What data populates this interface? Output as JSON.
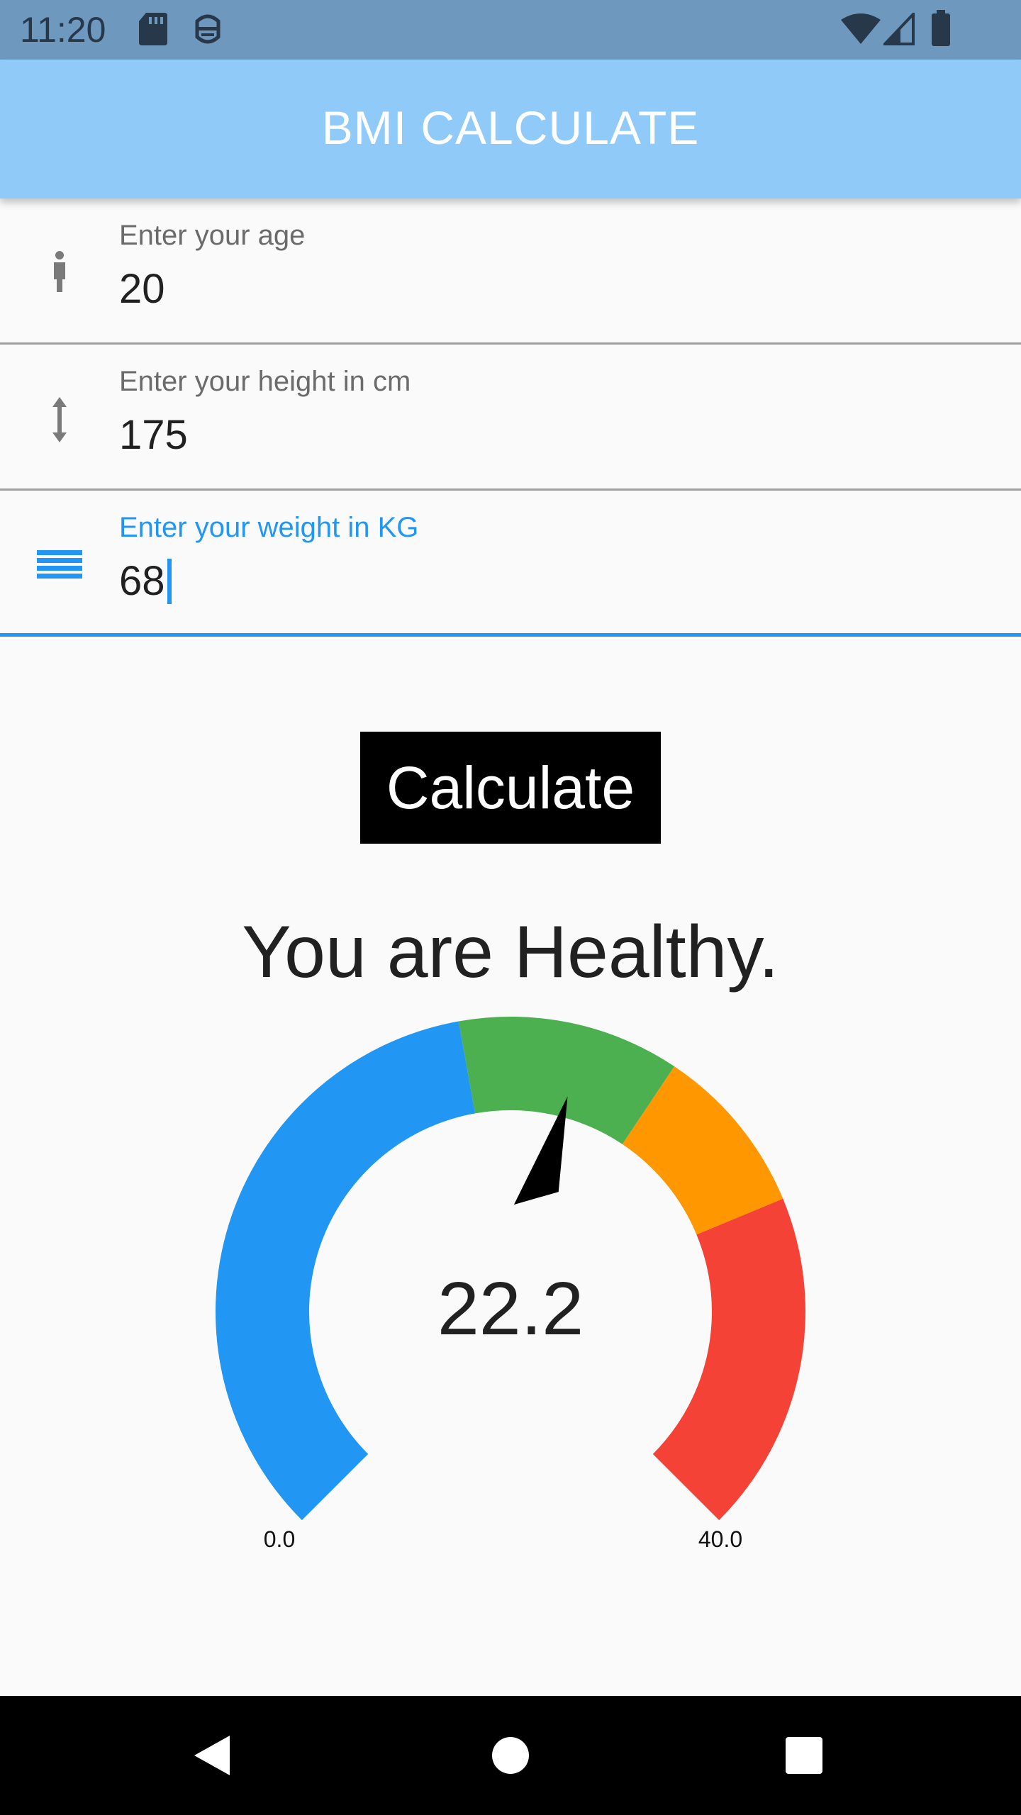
{
  "status_bar": {
    "time": "11:20",
    "left_icons": [
      "sd-card-icon",
      "android-debug-icon"
    ],
    "right_icons": [
      "wifi-icon",
      "cell-signal-icon",
      "battery-icon"
    ]
  },
  "app_bar": {
    "title": "BMI CALCULATE",
    "color": "#90caf9"
  },
  "form": {
    "age": {
      "label": "Enter your age",
      "value": "20",
      "icon": "person-icon"
    },
    "height": {
      "label": "Enter your height in cm",
      "value": "175",
      "icon": "vertical-arrows-icon"
    },
    "weight": {
      "label": "Enter your weight in KG",
      "value": "68",
      "icon": "lines-icon",
      "focused": true
    }
  },
  "calculate_button": {
    "label": "Calculate"
  },
  "result": {
    "message": "You are Healthy."
  },
  "gauge": {
    "value": 22.2,
    "value_label": "22.2",
    "min": 0,
    "max": 40,
    "min_label": "0.0",
    "max_label": "40.0",
    "ranges": [
      {
        "from": 0,
        "to": 18.5,
        "color": "#2196f3"
      },
      {
        "from": 18.5,
        "to": 25,
        "color": "#4caf50"
      },
      {
        "from": 25,
        "to": 30,
        "color": "#ff9800"
      },
      {
        "from": 30,
        "to": 40,
        "color": "#f44336"
      }
    ],
    "needle_color": "#000000"
  },
  "nav_bar": {
    "buttons": [
      "back-icon",
      "home-icon",
      "recents-icon"
    ]
  }
}
